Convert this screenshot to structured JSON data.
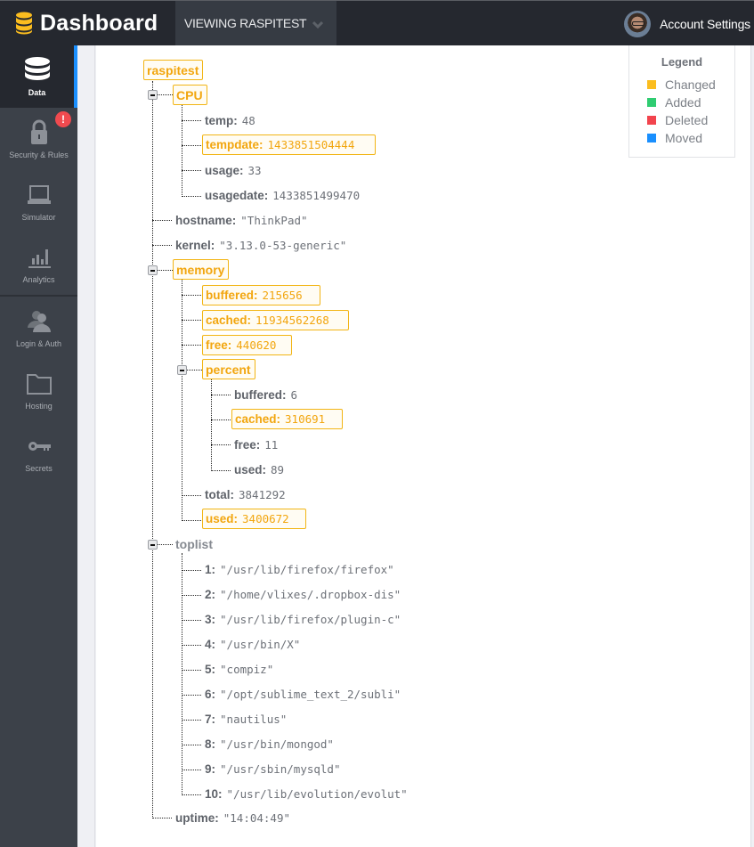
{
  "header": {
    "app_title": "Dashboard",
    "viewing_label": "VIEWING RASPITEST",
    "account_label": "Account Settings"
  },
  "sidebar": {
    "items": [
      {
        "label": "Data",
        "icon": "database-icon",
        "active": true
      },
      {
        "label": "Security & Rules",
        "icon": "lock-icon",
        "badge": "!"
      },
      {
        "label": "Simulator",
        "icon": "laptop-icon"
      },
      {
        "label": "Analytics",
        "icon": "bar-chart-icon"
      },
      {
        "label": "Login & Auth",
        "icon": "users-icon"
      },
      {
        "label": "Hosting",
        "icon": "folder-icon"
      },
      {
        "label": "Secrets",
        "icon": "key-icon"
      }
    ]
  },
  "legend": {
    "title": "Legend",
    "items": [
      {
        "label": "Changed",
        "color": "#fbbd1f"
      },
      {
        "label": "Added",
        "color": "#2fcc71"
      },
      {
        "label": "Deleted",
        "color": "#f2444d"
      },
      {
        "label": "Moved",
        "color": "#1a8ffe"
      }
    ]
  },
  "tree": {
    "root": "raspitest",
    "cpu": {
      "label": "CPU",
      "temp": {
        "key": "temp:",
        "value": "48"
      },
      "tempdate": {
        "key": "tempdate:",
        "value": "1433851504444"
      },
      "usage": {
        "key": "usage:",
        "value": "33"
      },
      "usagedate": {
        "key": "usagedate:",
        "value": "1433851499470"
      }
    },
    "hostname": {
      "key": "hostname:",
      "value": "\"ThinkPad\""
    },
    "kernel": {
      "key": "kernel:",
      "value": "\"3.13.0-53-generic\""
    },
    "memory": {
      "label": "memory",
      "buffered": {
        "key": "buffered:",
        "value": "215656"
      },
      "cached": {
        "key": "cached:",
        "value": "11934562268"
      },
      "free": {
        "key": "free:",
        "value": "440620"
      },
      "percent": {
        "label": "percent",
        "buffered": {
          "key": "buffered:",
          "value": "6"
        },
        "cached": {
          "key": "cached:",
          "value": "310691"
        },
        "free": {
          "key": "free:",
          "value": "11"
        },
        "used": {
          "key": "used:",
          "value": "89"
        }
      },
      "total": {
        "key": "total:",
        "value": "3841292"
      },
      "used": {
        "key": "used:",
        "value": "3400672"
      }
    },
    "toplist": {
      "label": "toplist",
      "items": [
        {
          "key": "1:",
          "value": "\"/usr/lib/firefox/firefox\""
        },
        {
          "key": "2:",
          "value": "\"/home/vlixes/.dropbox-dis\""
        },
        {
          "key": "3:",
          "value": "\"/usr/lib/firefox/plugin-c\""
        },
        {
          "key": "4:",
          "value": "\"/usr/bin/X\""
        },
        {
          "key": "5:",
          "value": "\"compiz\""
        },
        {
          "key": "6:",
          "value": "\"/opt/sublime_text_2/subli\""
        },
        {
          "key": "7:",
          "value": "\"nautilus\""
        },
        {
          "key": "8:",
          "value": "\"/usr/bin/mongod\""
        },
        {
          "key": "9:",
          "value": "\"/usr/sbin/mysqld\""
        },
        {
          "key": "10:",
          "value": "\"/usr/lib/evolution/evolut\""
        }
      ]
    },
    "uptime": {
      "key": "uptime:",
      "value": "\"14:04:49\""
    }
  }
}
